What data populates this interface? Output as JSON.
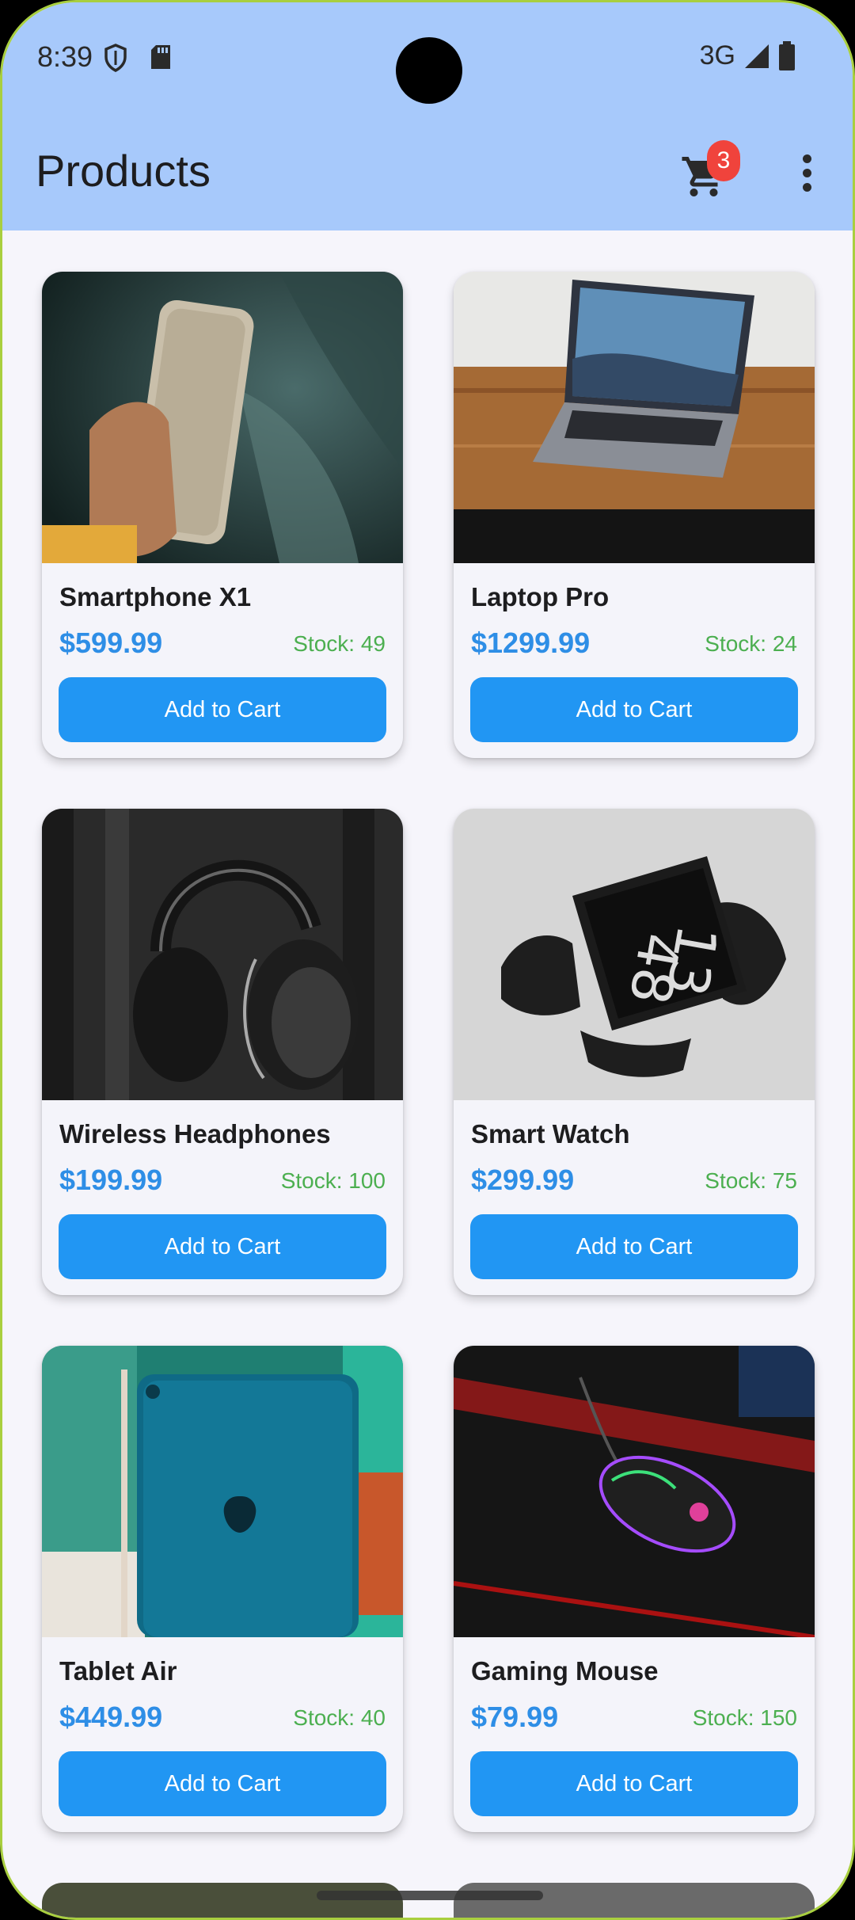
{
  "status_bar": {
    "time": "8:39",
    "network": "3G",
    "icons": [
      "shield-icon",
      "sd-card-icon",
      "signal-icon",
      "battery-icon"
    ]
  },
  "app_bar": {
    "title": "Products",
    "cart_count": "3",
    "icons": [
      "cart-icon",
      "more-vert-icon"
    ]
  },
  "products": [
    {
      "name": "Smartphone X1",
      "price": "$599.99",
      "stock": "Stock: 49",
      "button": "Add to Cart",
      "image": "smartphone-image"
    },
    {
      "name": "Laptop Pro",
      "price": "$1299.99",
      "stock": "Stock: 24",
      "button": "Add to Cart",
      "image": "laptop-image"
    },
    {
      "name": "Wireless Headphones",
      "price": "$199.99",
      "stock": "Stock: 100",
      "button": "Add to Cart",
      "image": "headphones-image"
    },
    {
      "name": "Smart Watch",
      "price": "$299.99",
      "stock": "Stock: 75",
      "button": "Add to Cart",
      "image": "smartwatch-image"
    },
    {
      "name": "Tablet Air",
      "price": "$449.99",
      "stock": "Stock: 40",
      "button": "Add to Cart",
      "image": "tablet-image"
    },
    {
      "name": "Gaming Mouse",
      "price": "$79.99",
      "stock": "Stock: 150",
      "button": "Add to Cart",
      "image": "mouse-image"
    }
  ],
  "colors": {
    "app_bar": "#a7c9fb",
    "price": "#2e8ee6",
    "stock": "#4caf50",
    "button": "#2196f3",
    "badge": "#f0433c"
  }
}
